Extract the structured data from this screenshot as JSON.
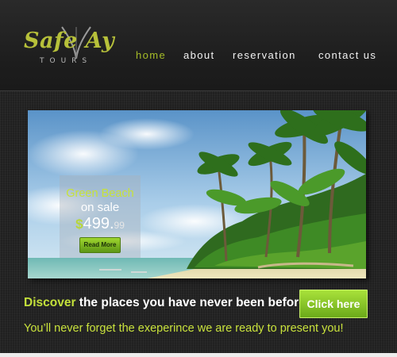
{
  "logo": {
    "main": "Safe  Ay",
    "sub": "TOURS"
  },
  "nav": {
    "items": [
      "home",
      "about",
      "reservation",
      "contact us"
    ],
    "active": "home"
  },
  "banner": {
    "title": "Green Beach",
    "subtitle": "on sale",
    "price_currency": "$",
    "price_main": "499.",
    "price_cents": "99",
    "button_label": "Read More"
  },
  "cta": {
    "headline_accent": "Discover",
    "headline_rest": " the places you have never been before",
    "button_label": "Click here"
  },
  "tagline": "You’ll never forget the exeperince we are ready to present you!",
  "colors": {
    "accent_green": "#a5bc27",
    "button_green": "#8cc92a",
    "header_bg": "#222222",
    "content_bg": "#232323"
  }
}
